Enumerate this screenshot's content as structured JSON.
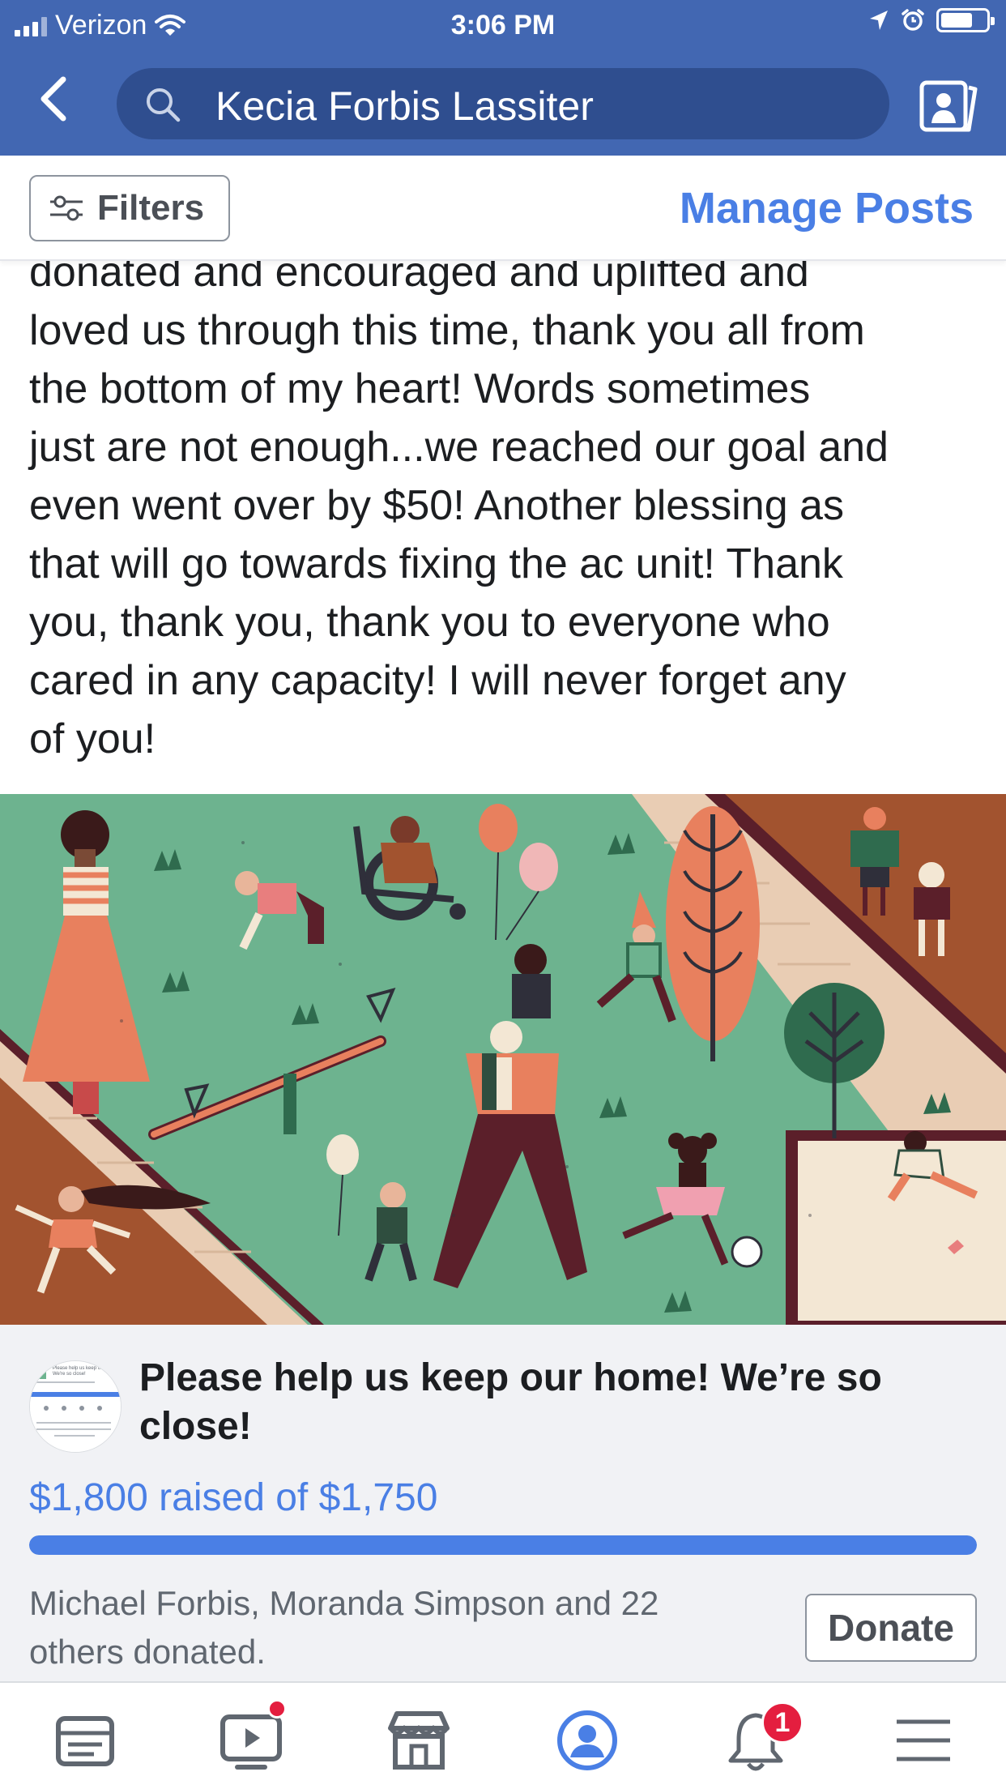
{
  "status_bar": {
    "carrier": "Verizon",
    "time": "3:06 PM"
  },
  "search": {
    "query": "Kecia Forbis Lassiter"
  },
  "toolbar": {
    "filters_label": "Filters",
    "manage_posts_label": "Manage Posts"
  },
  "post": {
    "lines": [
      "donated and encouraged and uplifted and",
      "loved us through this time, thank you all from",
      "the bottom of my heart! Words sometimes",
      "just are not enough...we reached our goal and",
      "even went over by $50! Another blessing as",
      "that will go towards fixing the ac unit! Thank",
      "you, thank you, thank you to everyone who",
      "cared in any capacity! I will never forget any",
      "of you!"
    ]
  },
  "fundraiser": {
    "title": "Please help us keep our home! We’re so close!",
    "raised_text": "$1,800 raised of $1,750",
    "progress_fraction": 1.0,
    "donors_text": "Michael Forbis, Moranda Simpson and 22 others donated.",
    "donate_label": "Donate",
    "thumbnail_title": "Please help us keep our home! We're so close!"
  },
  "tabbar": {
    "notifications_count": "1",
    "active_tab": "profile",
    "icons": [
      "news-feed-icon",
      "watch-icon",
      "marketplace-icon",
      "profile-icon",
      "notifications-icon",
      "menu-icon"
    ]
  },
  "colors": {
    "brand_blue": "#4267b2",
    "search_bg": "#2f4e8f",
    "link_blue": "#4a7fe5",
    "card_bg": "#f1f2f5",
    "badge_red": "#e41e3f",
    "illus_green": "#6db38f",
    "illus_brown": "#a2532f",
    "illus_orange": "#e8805e",
    "illus_maroon": "#5b1f2a"
  }
}
